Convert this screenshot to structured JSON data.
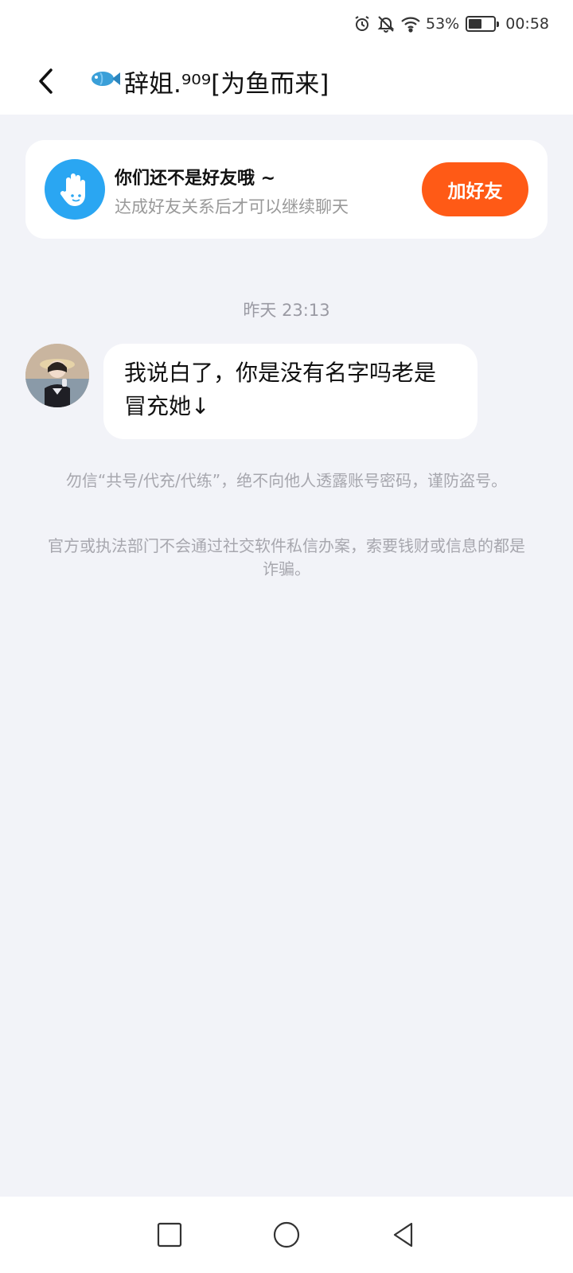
{
  "status_bar": {
    "battery_text": "53%",
    "battery_level": 0.53,
    "time": "00:58",
    "icons": [
      "alarm-icon",
      "bell-muted-icon",
      "wifi-icon",
      "battery-icon"
    ]
  },
  "header": {
    "title": "辞姐.⁹⁰⁹[为鱼而来]",
    "back_icon": "chevron-left-icon",
    "title_icon": "fish-icon"
  },
  "friend_banner": {
    "title": "你们还不是好友哦 ~",
    "subtitle": "达成好友关系后才可以继续聊天",
    "button_label": "加好友",
    "button_color": "#ff5a16",
    "icon": "waving-hand-icon",
    "icon_bg": "#2aa6f2"
  },
  "chat": {
    "timestamp": "昨天 23:13",
    "messages": [
      {
        "text": "我说白了，你是没有名字吗老是冒充她↓"
      }
    ]
  },
  "notices": [
    "勿信“共号/代充/代练”，绝不向他人透露账号密码，谨防盗号。",
    "官方或执法部门不会通过社交软件私信办案，索要钱财或信息的都是诈骗。"
  ],
  "nav_bar": {
    "buttons": [
      "recent-apps-icon",
      "home-icon",
      "back-triangle-icon"
    ]
  }
}
